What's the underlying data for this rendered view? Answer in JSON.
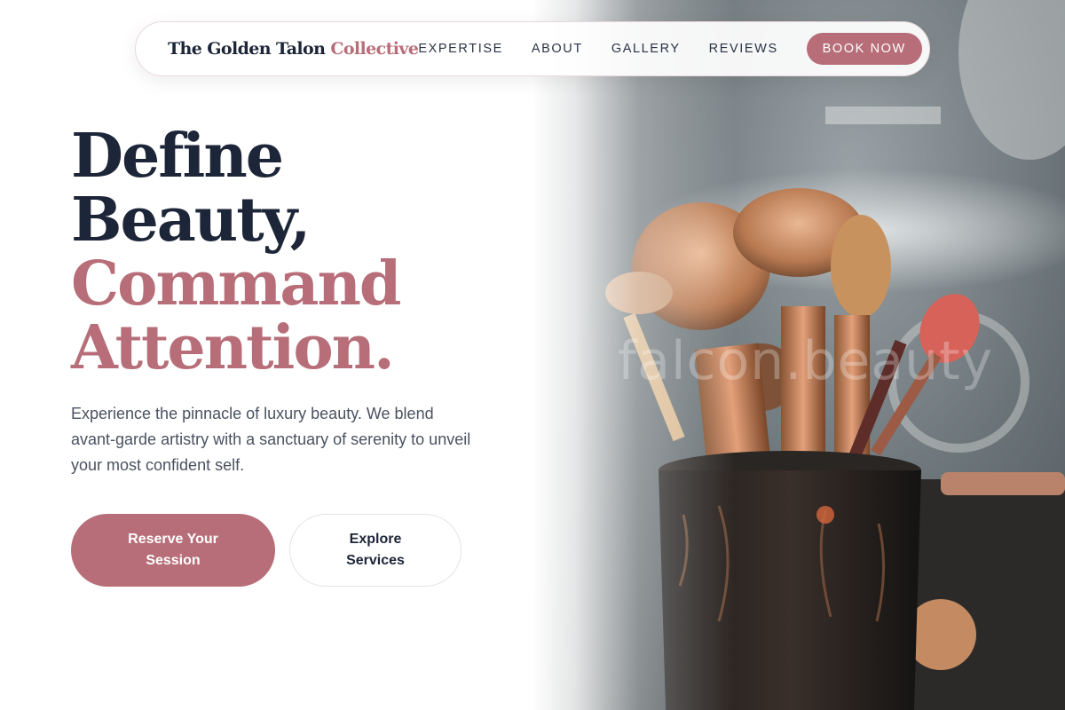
{
  "nav": {
    "brand_main": "The Golden Talon",
    "brand_accent": "Collective",
    "links": [
      "EXPERTISE",
      "ABOUT",
      "GALLERY",
      "REVIEWS"
    ],
    "cta_label": "BOOK NOW"
  },
  "hero": {
    "headline": [
      "Define",
      "Beauty,",
      "Command",
      "Attention."
    ],
    "lede": "Experience the pinnacle of luxury beauty. We blend avant-garde artistry with a sanctuary of serenity to unveil your most confident self.",
    "primary_cta": "Reserve Your Session",
    "secondary_cta": "Explore Services"
  },
  "image": {
    "subject": "makeup brushes in a dark cup",
    "watermark": "falcon.beauty"
  },
  "colors": {
    "accent": "#b76e79",
    "navy": "#1d2638",
    "body_text": "#4a5260"
  }
}
